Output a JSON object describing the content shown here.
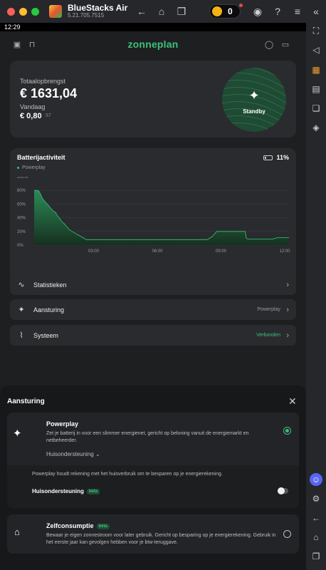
{
  "window": {
    "app_name": "BlueStacks Air",
    "version": "5.21.705.7515",
    "coin_count": "0",
    "traffic_light_colors": [
      "#ff5f57",
      "#febc2e",
      "#28c840"
    ]
  },
  "statusbar": {
    "time": "12:29"
  },
  "app": {
    "logo": "zonneplan",
    "header_left_icons": [
      "piggy-bank-icon",
      "shopping-bag-icon"
    ],
    "header_right_icons": [
      "profile-icon",
      "chat-icon"
    ]
  },
  "earnings": {
    "total_label": "Totaalopbrengst",
    "total_value": "€ 1631,04",
    "today_label": "Vandaag",
    "today_value": "€ 0,80",
    "today_suffix": "57",
    "status": "Standby"
  },
  "battery": {
    "title": "Batterijactiviteit",
    "percentage": "11%",
    "legend": "Powerplay",
    "accent": "#3ec07a"
  },
  "chart_data": {
    "type": "area",
    "series": [
      {
        "name": "Powerplay",
        "values": [
          80,
          80,
          80,
          80,
          79,
          76,
          72,
          68,
          66,
          64,
          62,
          60,
          58,
          56,
          54,
          52,
          50,
          49,
          48,
          45,
          42,
          40,
          38,
          35,
          33,
          32,
          30,
          28,
          26,
          24,
          22,
          21,
          20,
          19,
          18,
          17,
          16,
          15,
          14,
          13,
          12,
          11,
          10,
          9,
          8,
          8,
          8,
          8,
          8,
          8,
          8,
          8,
          8,
          8,
          8,
          8,
          8,
          8,
          8,
          8,
          8,
          8,
          8,
          8,
          8,
          8,
          8,
          8,
          8,
          8,
          8,
          8,
          8,
          8,
          8,
          8,
          8,
          8,
          8,
          8,
          8,
          8,
          8,
          8,
          8,
          8,
          8,
          8,
          8,
          8,
          8,
          8,
          8,
          8,
          8,
          8,
          8,
          8,
          8,
          8,
          8,
          8,
          8,
          8,
          8,
          8,
          8,
          8,
          8,
          8,
          8,
          8,
          8,
          8,
          8,
          8,
          8,
          8,
          8,
          8,
          8,
          8,
          8,
          8,
          8,
          8,
          8,
          8,
          8,
          8,
          8,
          8,
          8,
          8,
          8,
          8,
          8,
          8,
          8,
          8,
          8,
          8,
          8,
          8,
          8,
          8,
          8,
          9,
          10,
          11,
          12,
          14,
          16,
          18,
          20,
          20,
          20,
          20,
          20,
          20,
          20,
          20,
          20,
          20,
          20,
          20,
          20,
          20,
          20,
          20,
          20,
          20,
          20,
          20,
          20,
          20,
          20,
          20,
          20,
          10,
          9,
          9,
          9,
          9,
          9,
          9,
          9,
          9,
          9,
          9,
          9,
          9,
          9,
          9,
          9,
          9,
          9,
          9,
          9,
          9,
          9,
          9,
          9,
          10,
          10,
          11,
          11,
          11,
          11,
          11,
          11,
          11,
          11,
          11,
          11,
          11
        ]
      }
    ],
    "x_ticks": [
      "03:00",
      "06:00",
      "09:00",
      "12:00"
    ],
    "y_ticks": [
      "0%",
      "20%",
      "40%",
      "60%",
      "80%",
      "100%"
    ],
    "ylim": [
      0,
      100
    ],
    "grid": true
  },
  "nav_rows": [
    {
      "label": "Statistieken",
      "icon": "trend-line-icon",
      "status": "",
      "status_color": "#9a9a9a"
    },
    {
      "label": "Aansturing",
      "icon": "sparkle-icon",
      "status": "Powerplay",
      "status_color": "#9a9a9a"
    },
    {
      "label": "Systeem",
      "icon": "pulse-icon",
      "status": "Verbonden",
      "status_color": "#3ec07a"
    }
  ],
  "sheet": {
    "title": "Aansturing",
    "powerplay": {
      "title": "Powerplay",
      "description": "Zet je batterij in voor een slimmer energienet, gericht op beloning vanuit de energiemarkt en netbeheerder.",
      "sub_select": "Huisondersteuning",
      "sub_note": "Powerplay houdt rekening met het huisverbruik om te besparen op je energierekening.",
      "sub_label": "Huisondersteuning",
      "sub_badge": "bèta",
      "selected": true,
      "toggle_on": false
    },
    "zelfconsumptie": {
      "title": "Zelfconsumptie",
      "badge": "bèta",
      "description": "Bewaar je eigen zonnestroom voor later gebruik. Gericht op besparing op je energierekening. Gebruik in het eerste jaar kan gevolgen hebben voor je btw-teruggave.",
      "selected": false
    }
  },
  "side_toolbar": [
    "collapse-icon",
    "fullscreen-icon",
    "volume-icon",
    "keyboard-icon",
    "apk-icon",
    "multi-instance-icon",
    "layers-icon",
    "discord-icon",
    "settings-icon",
    "back-icon",
    "home-icon",
    "recents-icon"
  ]
}
